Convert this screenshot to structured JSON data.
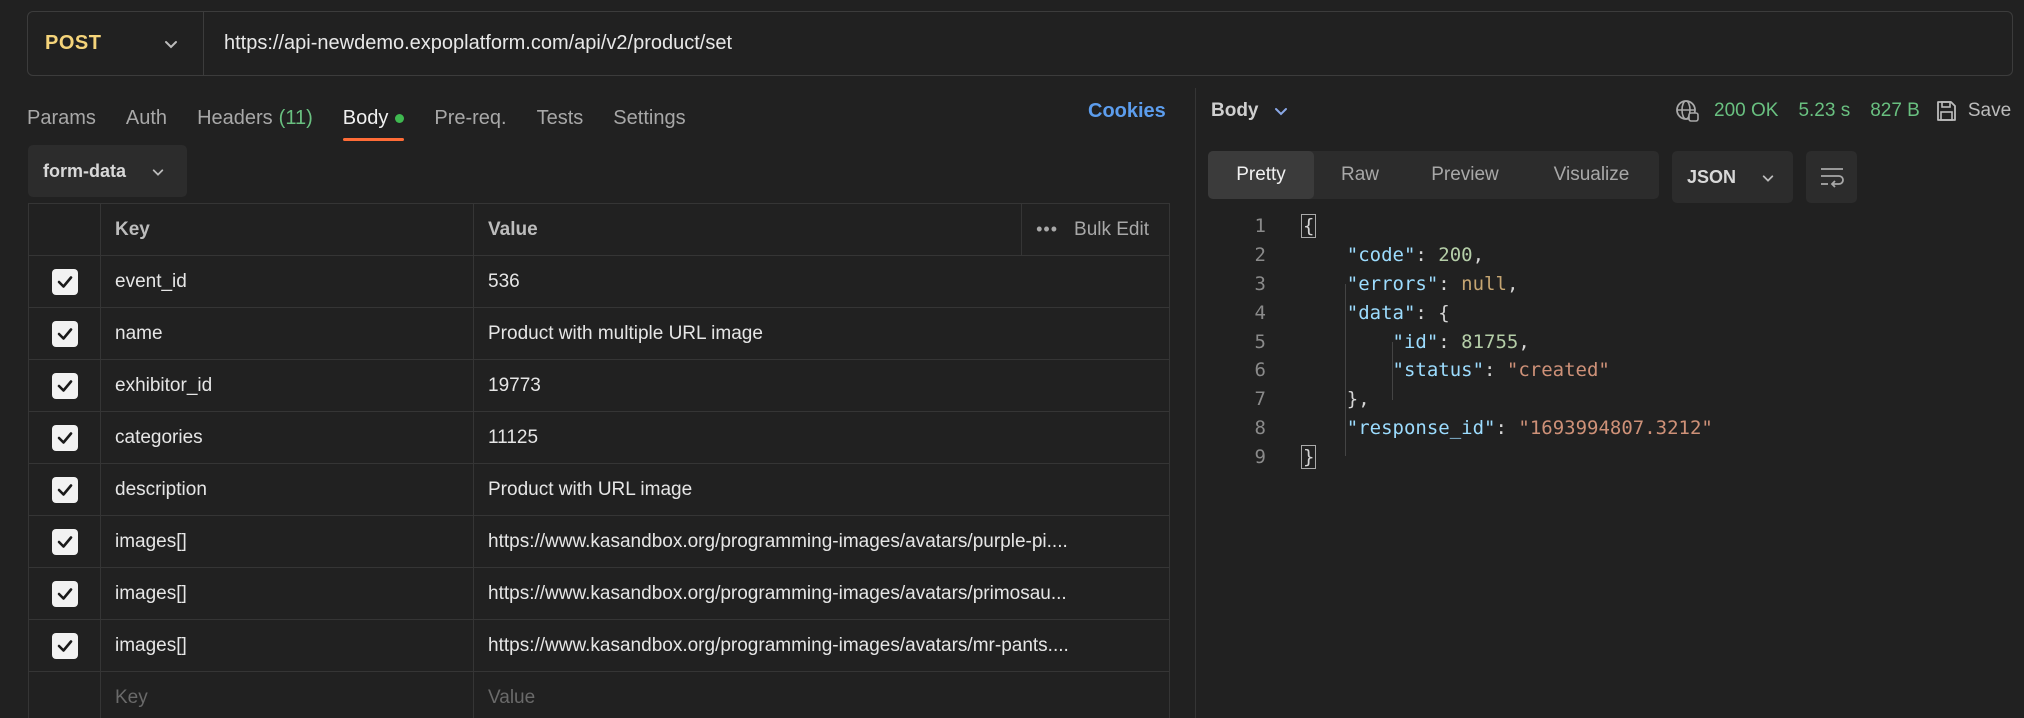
{
  "request": {
    "method": "POST",
    "url": "https://api-newdemo.expoplatform.com/api/v2/product/set"
  },
  "request_tabs": [
    {
      "label": "Params"
    },
    {
      "label": "Auth"
    },
    {
      "label": "Headers",
      "count": "(11)"
    },
    {
      "label": "Body"
    },
    {
      "label": "Pre-req."
    },
    {
      "label": "Tests"
    },
    {
      "label": "Settings"
    }
  ],
  "cookies_label": "Cookies",
  "body_type": "form-data",
  "table": {
    "key_header": "Key",
    "value_header": "Value",
    "more_icon": "•••",
    "bulk_edit": "Bulk Edit",
    "rows": [
      {
        "key": "event_id",
        "value": "536"
      },
      {
        "key": "name",
        "value": "Product with multiple URL image"
      },
      {
        "key": "exhibitor_id",
        "value": "19773"
      },
      {
        "key": "categories",
        "value": "11125"
      },
      {
        "key": "description",
        "value": "Product with URL image"
      },
      {
        "key": "images[]",
        "value": "https://www.kasandbox.org/programming-images/avatars/purple-pi...."
      },
      {
        "key": "images[]",
        "value": "https://www.kasandbox.org/programming-images/avatars/primosau..."
      },
      {
        "key": "images[]",
        "value": "https://www.kasandbox.org/programming-images/avatars/mr-pants...."
      }
    ],
    "key_placeholder": "Key",
    "value_placeholder": "Value"
  },
  "response": {
    "body_label": "Body",
    "status": "200 OK",
    "time": "5.23 s",
    "size": "827 B",
    "save_label": "Save",
    "view_tabs": [
      "Pretty",
      "Raw",
      "Preview",
      "Visualize"
    ],
    "language": "JSON",
    "line_numbers": [
      "1",
      "2",
      "3",
      "4",
      "5",
      "6",
      "7",
      "8",
      "9"
    ],
    "json": {
      "code_key": "\"code\"",
      "code_val": "200",
      "errors_key": "\"errors\"",
      "errors_val": "null",
      "data_key": "\"data\"",
      "id_key": "\"id\"",
      "id_val": "81755",
      "status_key": "\"status\"",
      "status_val": "\"created\"",
      "response_id_key": "\"response_id\"",
      "response_id_val": "\"1693994807.3212\""
    }
  }
}
